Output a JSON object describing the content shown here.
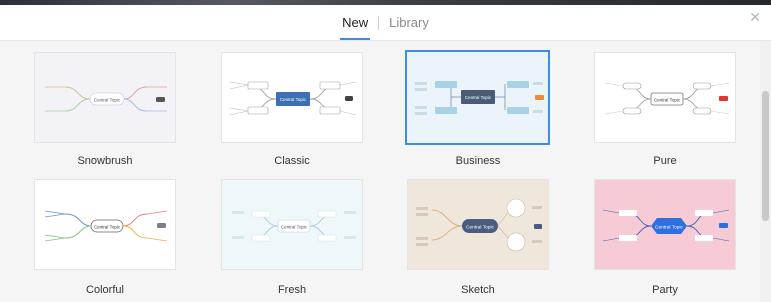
{
  "tabs": [
    {
      "label": "New",
      "active": true
    },
    {
      "label": "Library",
      "active": false
    }
  ],
  "close_icon": "✕",
  "templates": [
    {
      "name": "Snowbrush",
      "bg": "#f3f3f7",
      "center_text": "Central Topic",
      "selected": false
    },
    {
      "name": "Classic",
      "bg": "#ffffff",
      "center_text": "Central Topic",
      "selected": false
    },
    {
      "name": "Business",
      "bg": "#eaf4fa",
      "center_text": "Central Topic",
      "selected": true
    },
    {
      "name": "Pure",
      "bg": "#ffffff",
      "center_text": "Central Topic",
      "selected": false
    },
    {
      "name": "Colorful",
      "bg": "#ffffff",
      "center_text": "Central Topic",
      "selected": false
    },
    {
      "name": "Fresh",
      "bg": "#eef7fa",
      "center_text": "Central Topic",
      "selected": false
    },
    {
      "name": "Sketch",
      "bg": "#efe6dc",
      "center_text": "Central Topic",
      "selected": false
    },
    {
      "name": "Party",
      "bg": "#f7cbd5",
      "center_text": "Central Topic",
      "selected": false
    }
  ]
}
